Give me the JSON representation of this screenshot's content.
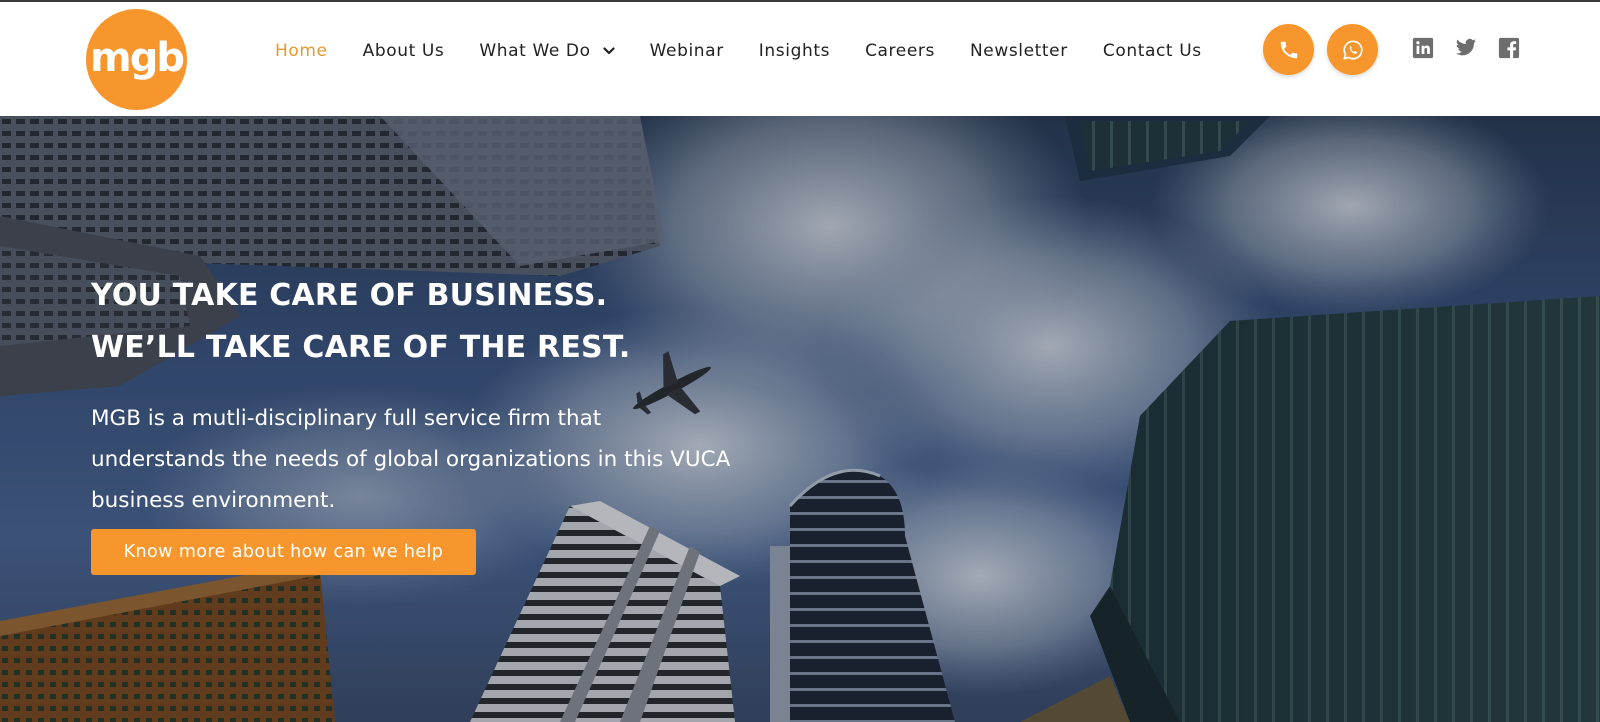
{
  "brand": {
    "logo_text": "mgb",
    "accent": "#f7962c"
  },
  "nav": {
    "items": [
      {
        "label": "Home",
        "active": true
      },
      {
        "label": "About Us"
      },
      {
        "label": "What We Do",
        "dropdown": true
      },
      {
        "label": "Webinar"
      },
      {
        "label": "Insights"
      },
      {
        "label": "Careers"
      },
      {
        "label": "Newsletter"
      },
      {
        "label": "Contact Us"
      }
    ]
  },
  "contact_buttons": {
    "phone_icon": "phone-icon",
    "whatsapp_icon": "whatsapp-icon"
  },
  "social": {
    "icons": [
      "linkedin-icon",
      "twitter-icon",
      "facebook-icon"
    ]
  },
  "hero": {
    "heading_line1": "YOU TAKE CARE OF BUSINESS.",
    "heading_line2": "WE’LL TAKE CARE OF THE REST.",
    "description_line1": "MGB is a mutli-disciplinary full service firm that",
    "description_line2": "understands the needs of global organizations in this VUCA",
    "description_line3": "business environment.",
    "cta_label": "Know more about how can we help"
  }
}
